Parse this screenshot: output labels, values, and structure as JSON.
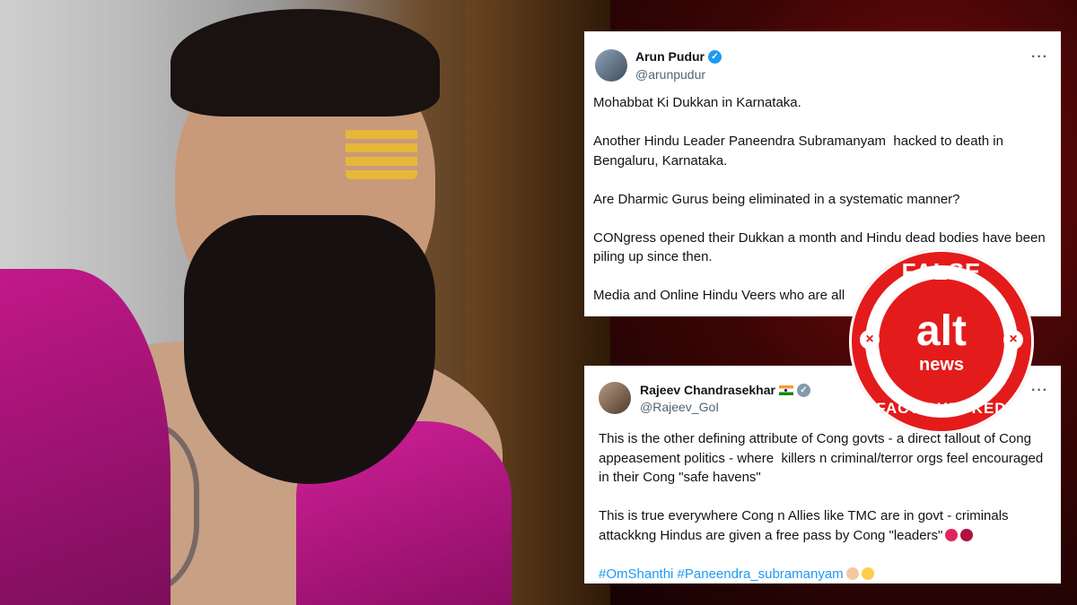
{
  "tweet1": {
    "name": "Arun Pudur",
    "handle": "@arunpudur",
    "more": "···",
    "text": "Mohabbat Ki Dukkan in Karnataka.\n\nAnother Hindu Leader Paneendra Subramanyam  hacked to death in Bengaluru, Karnataka.\n\nAre Dharmic Gurus being eliminated in a systematic manner?\n\nCONgress opened their Dukkan a month and Hindu dead bodies have been piling up since then.\n\nMedia and Online Hindu Veers who are all"
  },
  "tweet2": {
    "name": "Rajeev Chandrasekhar",
    "handle": "@Rajeev_GoI",
    "more": "···",
    "text": "This is the other defining attribute of Cong govts - a direct fallout of Cong appeasement politics - where  killers n criminal/terror orgs feel encouraged in their Cong \"safe havens\"\n\nThis is true everywhere Cong n Allies like TMC are in govt - criminals attackkng Hindus are given a free pass by Cong \"leaders\"",
    "hashtags": "#OmShanthi #Paneendra_subramanyam"
  },
  "stamp": {
    "top": "FALSE",
    "logo": "alt",
    "logo_sub": "news",
    "bottom": "FACT-CHECKED",
    "x_mark": "×"
  },
  "colors": {
    "stamp_red": "#e41b1b",
    "link_blue": "#1d9bf0",
    "verified_blue": "#1d9bf0",
    "verified_grey": "#829aab"
  },
  "icons": [
    "verified-badge-icon",
    "india-flag-icon",
    "more-options-icon",
    "angry-face-emoji-icon",
    "cursing-face-emoji-icon",
    "folded-hands-emoji-icon",
    "sad-face-emoji-icon"
  ]
}
